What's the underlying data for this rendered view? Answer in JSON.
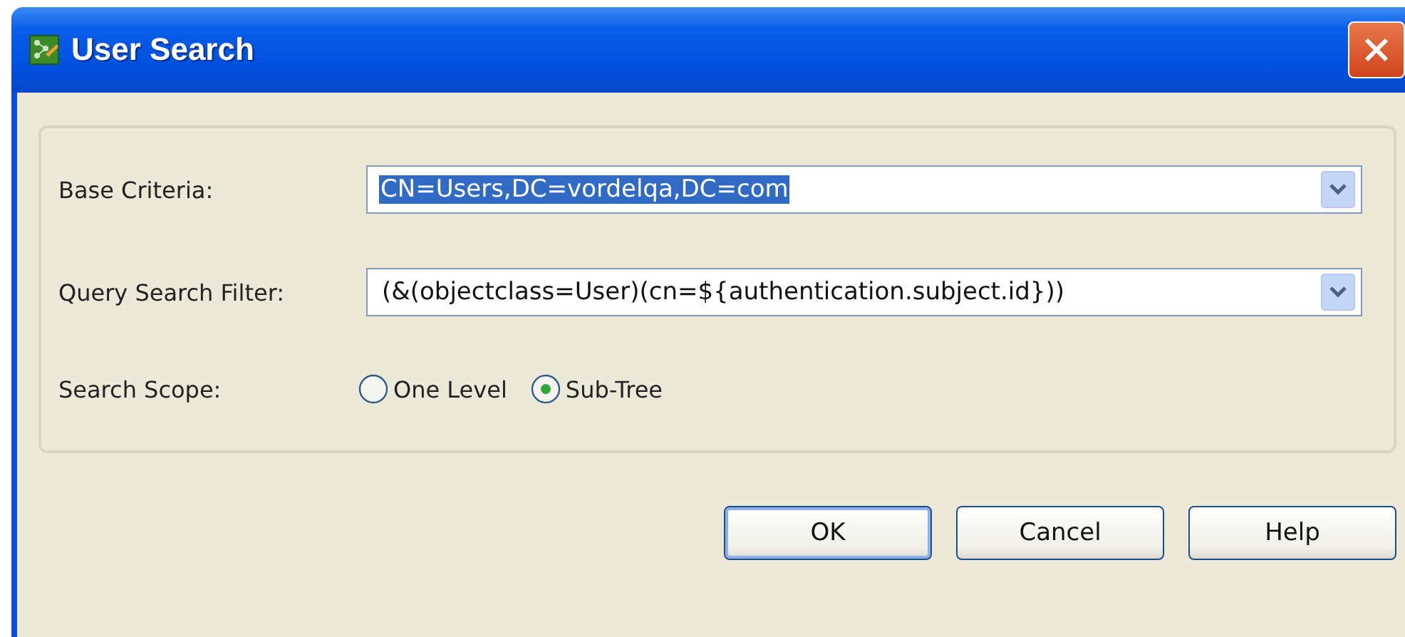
{
  "window": {
    "title": "User Search"
  },
  "fields": [
    {
      "label": "Base Criteria:",
      "value": "CN=Users,DC=vordelqa,DC=com",
      "text_selected": true
    },
    {
      "label": "Query Search Filter:",
      "value": "(&(objectclass=User)(cn=${authentication.subject.id}))",
      "text_selected": false
    }
  ],
  "search_scope": {
    "label": "Search Scope:",
    "options": [
      {
        "label": "One Level",
        "selected": false
      },
      {
        "label": "Sub-Tree",
        "selected": true
      }
    ]
  },
  "buttons": [
    {
      "label": "OK",
      "default": true
    },
    {
      "label": "Cancel",
      "default": false
    },
    {
      "label": "Help",
      "default": false
    }
  ]
}
